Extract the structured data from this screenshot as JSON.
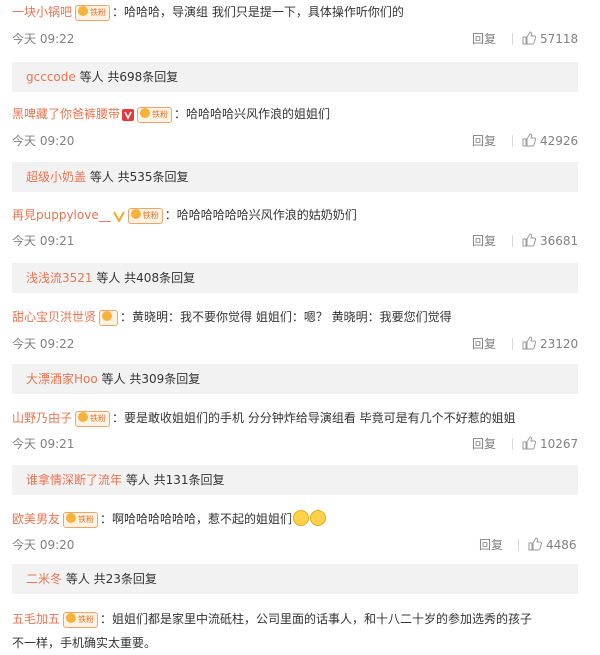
{
  "comments": [
    {
      "user": "一块小锅吧",
      "text": "：哈哈哈，导演组 我们只是提一下，具体操作听你们的",
      "time": "今天 09:22",
      "reply": "回复",
      "likes": "57118",
      "vip": false,
      "sub_user": "gcccode",
      "sub_text": " 等人 共698条回复"
    },
    {
      "user": "黑啤藏了你爸裤腰带",
      "text": "：哈哈哈哈兴风作浪的姐姐们",
      "time": "今天 09:20",
      "reply": "回复",
      "likes": "42926",
      "vip": true,
      "sub_user": "超级小奶盖",
      "sub_text": " 等人 共535条回复"
    },
    {
      "user": "再見puppylove__",
      "text": "：哈哈哈哈哈哈兴风作浪的姑奶奶们",
      "time": "今天 09:21",
      "reply": "回复",
      "likes": "36681",
      "vip": true,
      "sub_user": "浅浅流3521",
      "sub_text": " 等人 共408条回复"
    },
    {
      "user": "甜心宝贝洪世贤",
      "text": "：黄晓明：我不要你觉得 姐姐们：嗯？ 黄晓明：我要您们觉得",
      "time": "今天 09:22",
      "reply": "回复",
      "likes": "23120",
      "vip": false,
      "sub_user": "大漂酒家Hoo",
      "sub_text": " 等人 共309条回复"
    },
    {
      "user": "山野乃由子",
      "text": "：要是敢收姐姐们的手机 分分钟炸给导演组看 毕竟可是有几个不好惹的姐姐",
      "time": "今天 09:21",
      "reply": "回复",
      "likes": "10267",
      "vip": false,
      "sub_user": "谁拿情深断了流年",
      "sub_text": " 等人 共131条回复"
    },
    {
      "user": "欧美男友",
      "text": "：啊哈哈哈哈哈哈，惹不起的姐姐们",
      "time": "今天 09:20",
      "reply": "回复",
      "likes": "4486",
      "vip": false,
      "sub_user": "二米冬",
      "sub_text": " 等人 共23条回复"
    }
  ],
  "last": {
    "user": "五毛加五",
    "text1": "：姐姐们都是家里中流砥柱，公司里面的话事人，和十八二十岁的参加选秀的孩子",
    "text2": "不一样，手机确实太重要。"
  },
  "badge_label": "铁粉",
  "colors": {
    "username": "#eb7350",
    "badge": "#f7b23b"
  }
}
